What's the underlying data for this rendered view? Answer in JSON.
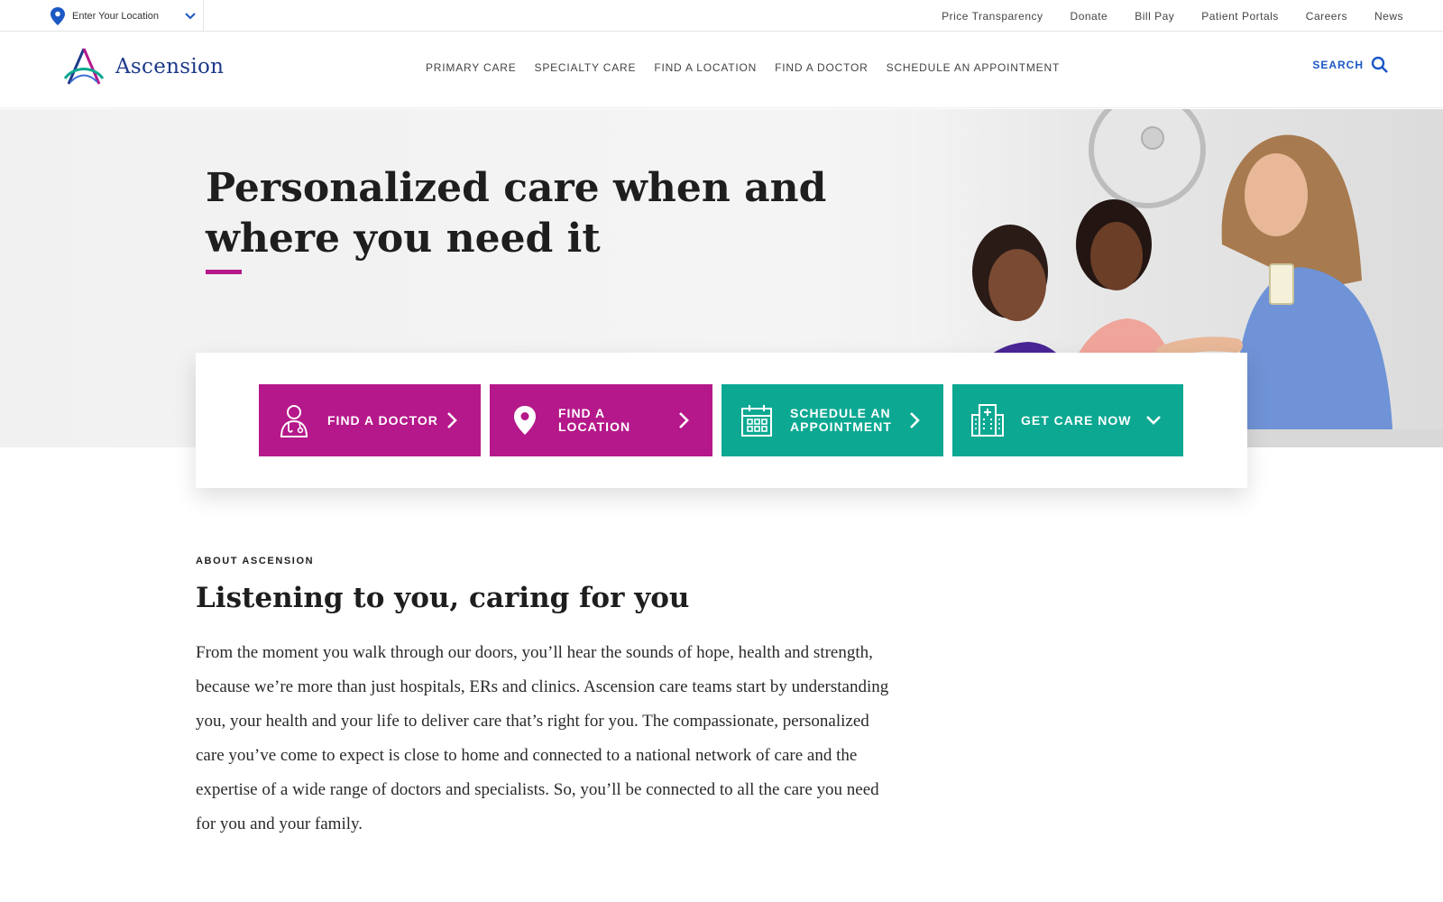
{
  "utility_bar": {
    "location_label": "Enter Your Location",
    "links": [
      "Price Transparency",
      "Donate",
      "Bill Pay",
      "Patient Portals",
      "Careers",
      "News"
    ]
  },
  "header": {
    "logo_text": "Ascension",
    "nav_items": [
      "PRIMARY CARE",
      "SPECIALTY CARE",
      "FIND A LOCATION",
      "FIND A DOCTOR",
      "SCHEDULE AN APPOINTMENT"
    ],
    "search_label": "SEARCH"
  },
  "hero": {
    "heading": "Personalized care when and where you need it"
  },
  "actions": [
    {
      "label": "FIND A DOCTOR",
      "icon": "doctor-icon",
      "arrow": "chevron-right-icon"
    },
    {
      "label": "FIND A LOCATION",
      "icon": "map-pin-icon",
      "arrow": "chevron-right-icon"
    },
    {
      "label": "SCHEDULE AN APPOINTMENT",
      "icon": "calendar-icon",
      "arrow": "chevron-right-icon"
    },
    {
      "label": "GET CARE NOW",
      "icon": "hospital-icon",
      "arrow": "chevron-down-icon"
    }
  ],
  "about": {
    "eyebrow": "ABOUT ASCENSION",
    "title": "Listening to you, caring for you",
    "body": "From the moment you walk through our doors, you’ll hear the sounds of hope, health and strength, because we’re more than just hospitals, ERs and clinics. Ascension care teams start by understanding you, your health and your life to deliver care that’s right for you. The compassionate, personalized care you’ve come to expect is close to home and connected to a national network of care and the expertise of a wide range of doctors and specialists. So, you’ll be connected to all the care you need for you and your family."
  },
  "colors": {
    "magenta": "#b5188a",
    "teal": "#0ca892",
    "brand_blue": "#1e3a8a",
    "link_blue": "#1b58c4"
  }
}
